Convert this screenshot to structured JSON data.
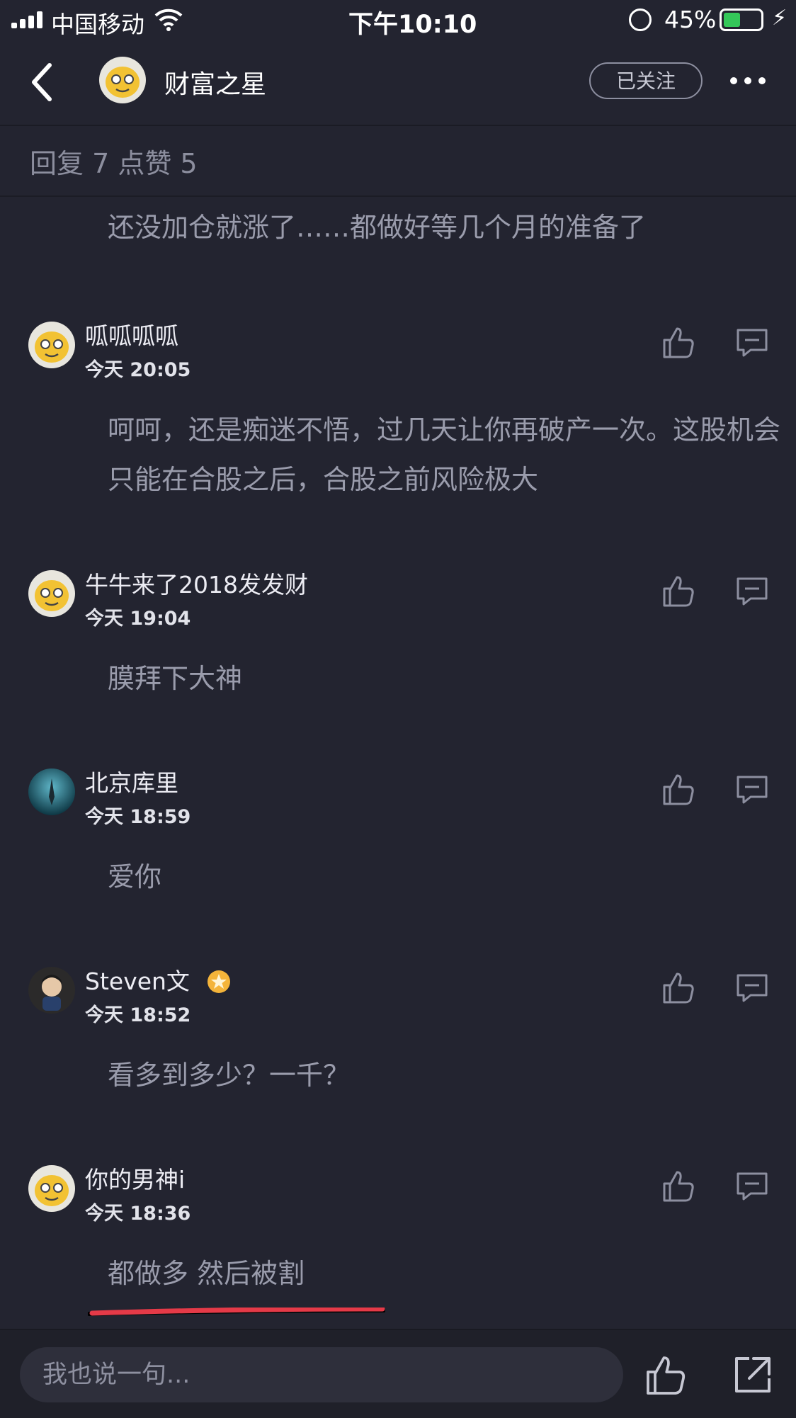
{
  "status_bar": {
    "carrier": "中国移动",
    "time": "下午10:10",
    "battery_pct": "45%",
    "battery_level": 0.45
  },
  "header": {
    "title": "财富之星",
    "follow_label": "已关注",
    "more_icon": "more-dots-icon",
    "back_icon": "chevron-left-icon"
  },
  "counts": "回复 7  点赞 5",
  "first_comment_text": "还没加仓就涨了……都做好等几个月的准备了",
  "comments": [
    {
      "name": "呱呱呱呱",
      "time": "今天 20:05",
      "text": "呵呵，还是痴迷不悟，过几天让你再破产一次。这股机会只能在合股之后，合股之前风险极大",
      "avatar": "tiger-avatar"
    },
    {
      "name": "牛牛来了2018发发财",
      "time": "今天 19:04",
      "text": "膜拜下大神",
      "avatar": "tiger-avatar"
    },
    {
      "name": "北京库里",
      "time": "今天 18:59",
      "text": "爱你",
      "avatar": "ocean-avatar"
    },
    {
      "name": "Steven文",
      "time": "今天 18:52",
      "text": "看多到多少？一千？",
      "avatar": "cartoon-avatar",
      "badge": "gold-star-badge"
    },
    {
      "name": "你的男神i",
      "time": "今天 18:36",
      "text": "都做多 然后被割",
      "avatar": "tiger-avatar"
    }
  ],
  "bottom_bar": {
    "placeholder": "我也说一句...",
    "like_icon": "thumbs-up-icon",
    "share_icon": "share-icon"
  },
  "colors": {
    "background": "#232430",
    "secondary_text": "#9a9cac",
    "battery_fill": "#34c759",
    "annotation_red": "#e53a48"
  }
}
